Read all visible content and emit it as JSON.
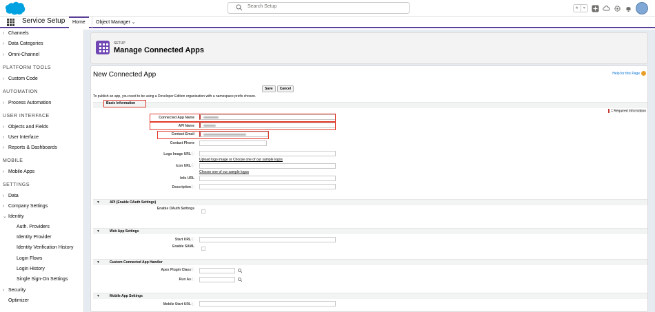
{
  "header": {
    "search_placeholder": "Search Setup",
    "icons": [
      "salesforce-cloud-logo",
      "search-icon",
      "favorites-star-icon",
      "favorites-list-icon",
      "add-icon",
      "trailhead-icon",
      "setup-gear-icon",
      "notification-bell-icon",
      "user-avatar"
    ],
    "brand_color": "#00a1e0"
  },
  "nav": {
    "app_name": "Service Setup",
    "tabs": [
      "Home",
      "Object Manager"
    ],
    "accent_color": "#5a3e9a"
  },
  "sidebar": {
    "items": [
      {
        "label": "Channels"
      },
      {
        "label": "Data Categories"
      },
      {
        "label": "Omni-Channel"
      },
      {
        "heading": "PLATFORM TOOLS"
      },
      {
        "label": "Custom Code"
      },
      {
        "heading": "AUTOMATION"
      },
      {
        "label": "Process Automation"
      },
      {
        "heading": "USER INTERFACE"
      },
      {
        "label": "Objects and Fields"
      },
      {
        "label": "User Interface"
      },
      {
        "label": "Reports & Dashboards"
      },
      {
        "heading": "MOBILE"
      },
      {
        "label": "Mobile Apps"
      },
      {
        "heading": "SETTINGS"
      },
      {
        "label": "Data"
      },
      {
        "label": "Company Settings"
      },
      {
        "label": "Identity",
        "expanded": true
      },
      {
        "label": "Auth. Providers",
        "sub": true
      },
      {
        "label": "Identity Provider",
        "sub": true
      },
      {
        "label": "Identity Verification History",
        "sub": true
      },
      {
        "label": "Login Flows",
        "sub": true
      },
      {
        "label": "Login History",
        "sub": true
      },
      {
        "label": "Single Sign-On Settings",
        "sub": true
      },
      {
        "label": "Security"
      },
      {
        "label": "Optimizer",
        "nochev": true
      }
    ]
  },
  "banner": {
    "kicker": "SETUP",
    "title": "Manage Connected Apps",
    "icon_color": "#6f46b3"
  },
  "form": {
    "title": "New Connected App",
    "help_link": "Help for this Page",
    "save": "Save",
    "cancel": "Cancel",
    "note": "To publish an app, you need to be using a Developer Edition organization with a namespace prefix chosen.",
    "basic_info": "Basic Information",
    "required_info": "= Required Information",
    "fields": {
      "connected_app_name": "Connected App Name",
      "api_name": "API Name",
      "contact_email": "Contact Email",
      "contact_phone": "Contact Phone",
      "logo_image_url": "Logo Image URL",
      "upload_logo": "Upload logo image",
      "or": "or",
      "choose_logos": "Choose one of our sample logos",
      "icon_url": "Icon URL",
      "choose_logos_2": "Choose one of our sample logos",
      "info_url": "Info URL",
      "description": "Description"
    },
    "sections": {
      "api": "API (Enable OAuth Settings)",
      "enable_oauth": "Enable OAuth Settings",
      "web_app": "Web App Settings",
      "start_url": "Start URL",
      "enable_saml": "Enable SAML",
      "custom_handler": "Custom Connected App Handler",
      "apex_plugin": "Apex Plugin Class",
      "run_as": "Run As",
      "mobile_app": "Mobile App Settings",
      "mobile_start_url": "Mobile Start URL"
    },
    "highlight_color": "#e03a2b"
  }
}
